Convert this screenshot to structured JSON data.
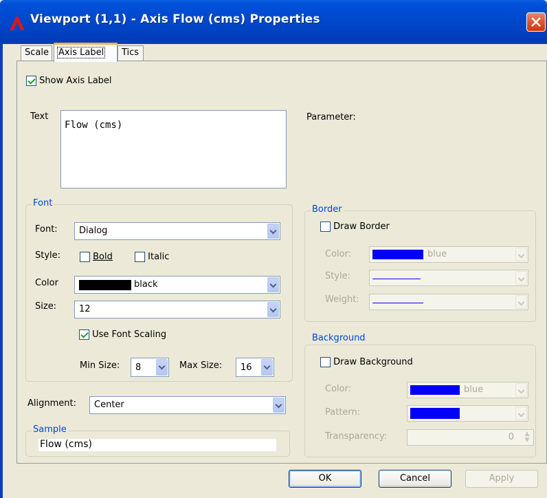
{
  "window": {
    "title": "Viewport (1,1) - Axis Flow (cms) Properties"
  },
  "tabs": [
    {
      "label": "Scale"
    },
    {
      "label": "Axis Label"
    },
    {
      "label": "Tics"
    }
  ],
  "show_axis_label": {
    "label": "Show Axis Label",
    "checked": true
  },
  "text_field": {
    "label": "Text",
    "value": "Flow (cms)"
  },
  "parameter": {
    "label": "Parameter:"
  },
  "font_group": {
    "title": "Font",
    "font_label": "Font:",
    "font_value": "Dialog",
    "style_label": "Style:",
    "bold_label": "Bold",
    "italic_label": "Italic",
    "color_label": "Color",
    "color_value": "black",
    "size_label": "Size:",
    "size_value": "12",
    "use_scaling_label": "Use Font Scaling",
    "min_label": "Min Size:",
    "min_value": "8",
    "max_label": "Max Size:",
    "max_value": "16"
  },
  "alignment": {
    "label": "Alignment:",
    "value": "Center"
  },
  "sample": {
    "title": "Sample",
    "text": "Flow (cms)"
  },
  "border_group": {
    "title": "Border",
    "draw_label": "Draw Border",
    "color_label": "Color:",
    "color_value": "blue",
    "style_label": "Style:",
    "weight_label": "Weight:"
  },
  "background_group": {
    "title": "Background",
    "draw_label": "Draw Background",
    "color_label": "Color:",
    "color_value": "blue",
    "pattern_label": "Pattern:",
    "transparency_label": "Transparency:",
    "transparency_value": "0"
  },
  "buttons": {
    "ok": "OK",
    "cancel": "Cancel",
    "apply": "Apply"
  },
  "colors": {
    "accent": "#0046d5",
    "swatch_blue": "#0000f8",
    "swatch_black": "#000000"
  }
}
